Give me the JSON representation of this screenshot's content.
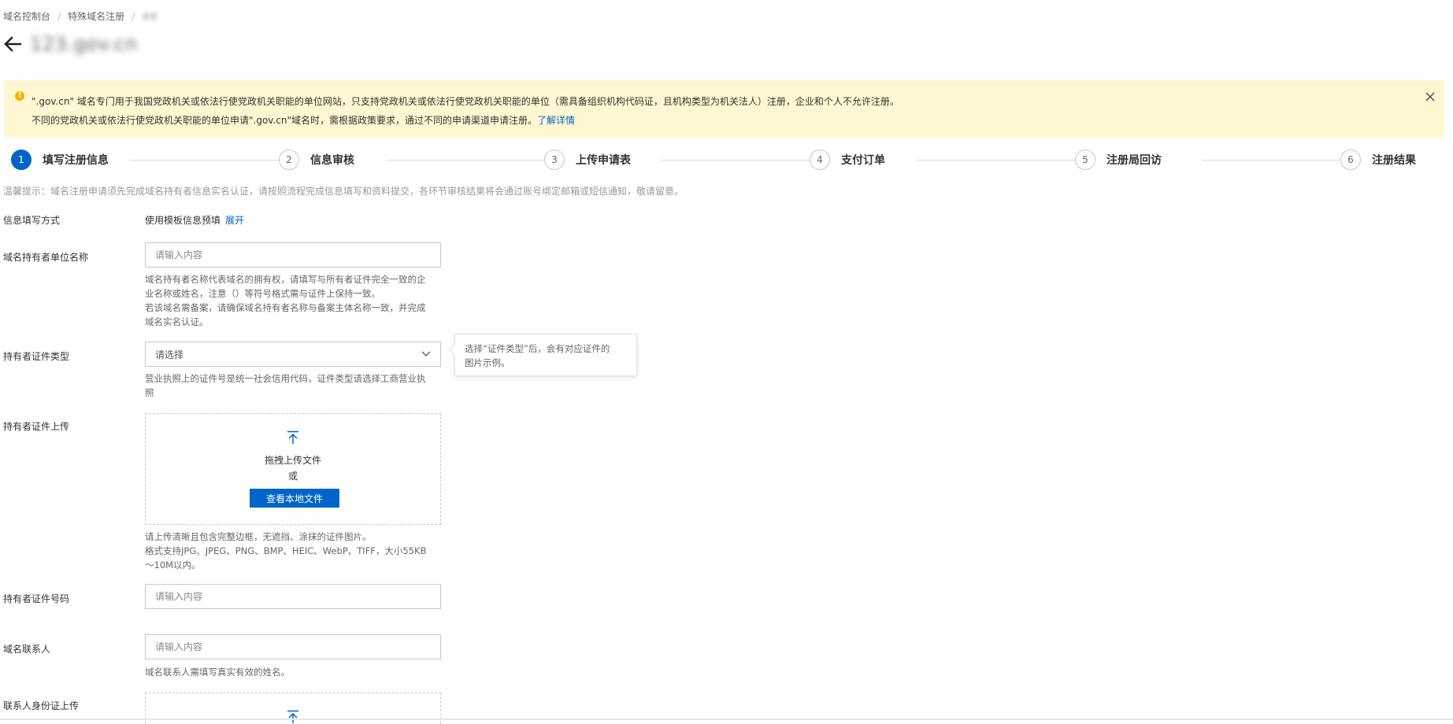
{
  "breadcrumb": {
    "items": [
      "域名控制台",
      "特殊域名注册"
    ],
    "current": "##",
    "separator": "/"
  },
  "page": {
    "title": "123.gov.cn"
  },
  "alert": {
    "line1": "\".gov.cn\" 域名专门用于我国党政机关或依法行使党政机关职能的单位网站，只支持党政机关或依法行使党政机关职能的单位（需具备组织机构代码证，且机构类型为机关法人）注册，企业和个人不允许注册。",
    "line2": "不同的党政机关或依法行使党政机关职能的单位申请\".gov.cn\"域名时，需根据政策要求，通过不同的申请渠道申请注册。",
    "link": "了解详情",
    "warn_glyph": "!"
  },
  "steps": [
    {
      "num": "1",
      "label": "填写注册信息"
    },
    {
      "num": "2",
      "label": "信息审核"
    },
    {
      "num": "3",
      "label": "上传申请表"
    },
    {
      "num": "4",
      "label": "支付订单"
    },
    {
      "num": "5",
      "label": "注册局回访"
    },
    {
      "num": "6",
      "label": "注册结果"
    }
  ],
  "tip": "温馨提示：域名注册申请须先完成域名持有者信息实名认证，请按照流程完成信息填写和资料提交，各环节审核结果将会通过账号绑定邮箱或短信通知，敬请留意。",
  "form": {
    "fill_method": {
      "label": "信息填写方式",
      "value": "使用模板信息预填",
      "link": "展开"
    },
    "holder_name": {
      "label": "域名持有者单位名称",
      "placeholder": "请输入内容",
      "help": [
        "域名持有者名称代表域名的拥有权，请填写与所有者证件完全一致的企",
        "业名称或姓名，注意（）等符号格式需与证件上保持一致。",
        "若该域名需备案，请确保域名持有者名称与备案主体名称一致，并完成",
        "域名实名认证。"
      ]
    },
    "cert_type": {
      "label": "持有者证件类型",
      "placeholder": "请选择",
      "help": [
        "营业执照上的证件号是统一社会信用代码，证件类型请选择工商营业执",
        "照"
      ],
      "tooltip": [
        "选择“证件类型”后，会有对应证件的",
        "图片示例。"
      ]
    },
    "cert_upload": {
      "label": "持有者证件上传",
      "drag_text": "拖拽上传文件",
      "or_text": "或",
      "button": "查看本地文件",
      "help": [
        "请上传清晰且包含完整边框，无遮挡、涂抹的证件图片。",
        "格式支持JPG、JPEG、PNG、BMP、HEIC、WebP、TIFF，大小55KB",
        "～10M以内。"
      ]
    },
    "cert_number": {
      "label": "持有者证件号码",
      "placeholder": "请输入内容"
    },
    "contact": {
      "label": "域名联系人",
      "placeholder": "请输入内容",
      "help": "域名联系人需填写真实有效的姓名。"
    },
    "contact_id_upload": {
      "label": "联系人身份证上传"
    }
  },
  "colors": {
    "primary": "#0064c8",
    "alert_bg": "#fff7d1",
    "warn": "#f5b400"
  },
  "icons": {
    "back": "arrow-left-icon",
    "close": "close-icon",
    "upload": "upload-icon",
    "select": "chevron-down-icon",
    "warning": "warning-icon"
  }
}
